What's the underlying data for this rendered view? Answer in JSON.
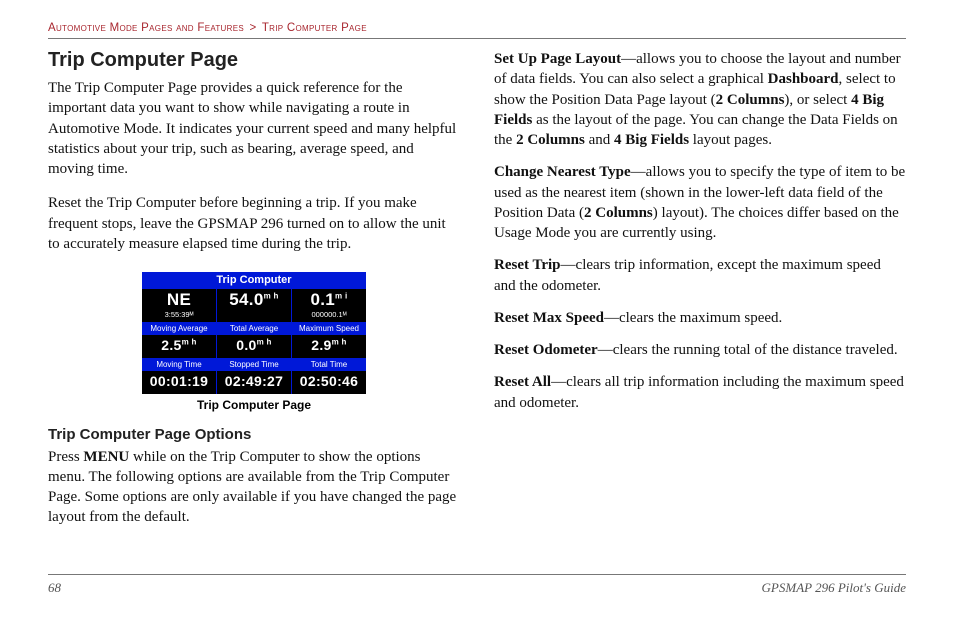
{
  "breadcrumb": {
    "section": "Automotive Mode Pages and Features",
    "page": "Trip Computer Page"
  },
  "left": {
    "title": "Trip Computer Page",
    "intro": "The Trip Computer Page provides a quick reference for the important data you want to show while navigating a route in Automotive Mode. It indicates your current speed and many helpful statistics about your trip, such as bearing, average speed, and moving time.",
    "reset": "Reset the Trip Computer before beginning a trip. If you make frequent stops, leave the GPSMAP 296 turned on to allow the unit to accurately measure elapsed time during the trip.",
    "caption": "Trip Computer Page",
    "options_title": "Trip Computer Page Options",
    "options_intro_1": "Press ",
    "options_intro_menu": "MENU",
    "options_intro_2": " while on the Trip Computer to show the options menu. The following options are available from the Trip Computer Page. Some options are only available if you have changed the page layout from the default."
  },
  "figure": {
    "title": "Trip Computer",
    "row1": {
      "heading": "NE",
      "heading_sub": "3:55:39ᴹ",
      "speed": "54.0",
      "speed_unit": "m h",
      "odo": "0.1",
      "odo_unit": "m i",
      "odo_sub": "000000.1ᴹ"
    },
    "labels1": [
      "Moving Average",
      "Total Average",
      "Maximum Speed"
    ],
    "row2": {
      "a": "2.5",
      "b": "0.0",
      "c": "2.9",
      "unit": "m h"
    },
    "labels2": [
      "Moving Time",
      "Stopped Time",
      "Total Time"
    ],
    "row3": {
      "a": "00:01:19",
      "b": "02:49:27",
      "c": "02:50:46"
    }
  },
  "right": {
    "setup_label": "Set Up Page Layout",
    "setup_1": "—allows you to choose the layout and number of data fields. You can also select a graphical ",
    "setup_dash": "Dashboard",
    "setup_2": ", select to show the Position Data Page layout (",
    "setup_2col": "2 Columns",
    "setup_3": "), or select ",
    "setup_4big": "4 Big Fields",
    "setup_4": " as the layout of the page. You can change the Data Fields on the ",
    "setup_5": " and ",
    "setup_6": " layout pages.",
    "change_label": "Change Nearest Type",
    "change_1": "—allows you to specify the type of item to be used as the nearest item (shown in the lower-left data field of the Position Data (",
    "change_2": ") layout). The choices differ based on the Usage Mode you are currently using.",
    "rtrip_label": "Reset Trip",
    "rtrip_text": "—clears trip information, except the maximum speed and the odometer.",
    "rmax_label": "Reset Max Speed",
    "rmax_text": "—clears the maximum speed.",
    "rodo_label": "Reset Odometer",
    "rodo_text": "—clears the running total of the distance traveled.",
    "rall_label": "Reset All",
    "rall_text": "—clears all trip information including the maximum speed and odometer."
  },
  "footer": {
    "page": "68",
    "book": "GPSMAP 296 Pilot's Guide"
  }
}
